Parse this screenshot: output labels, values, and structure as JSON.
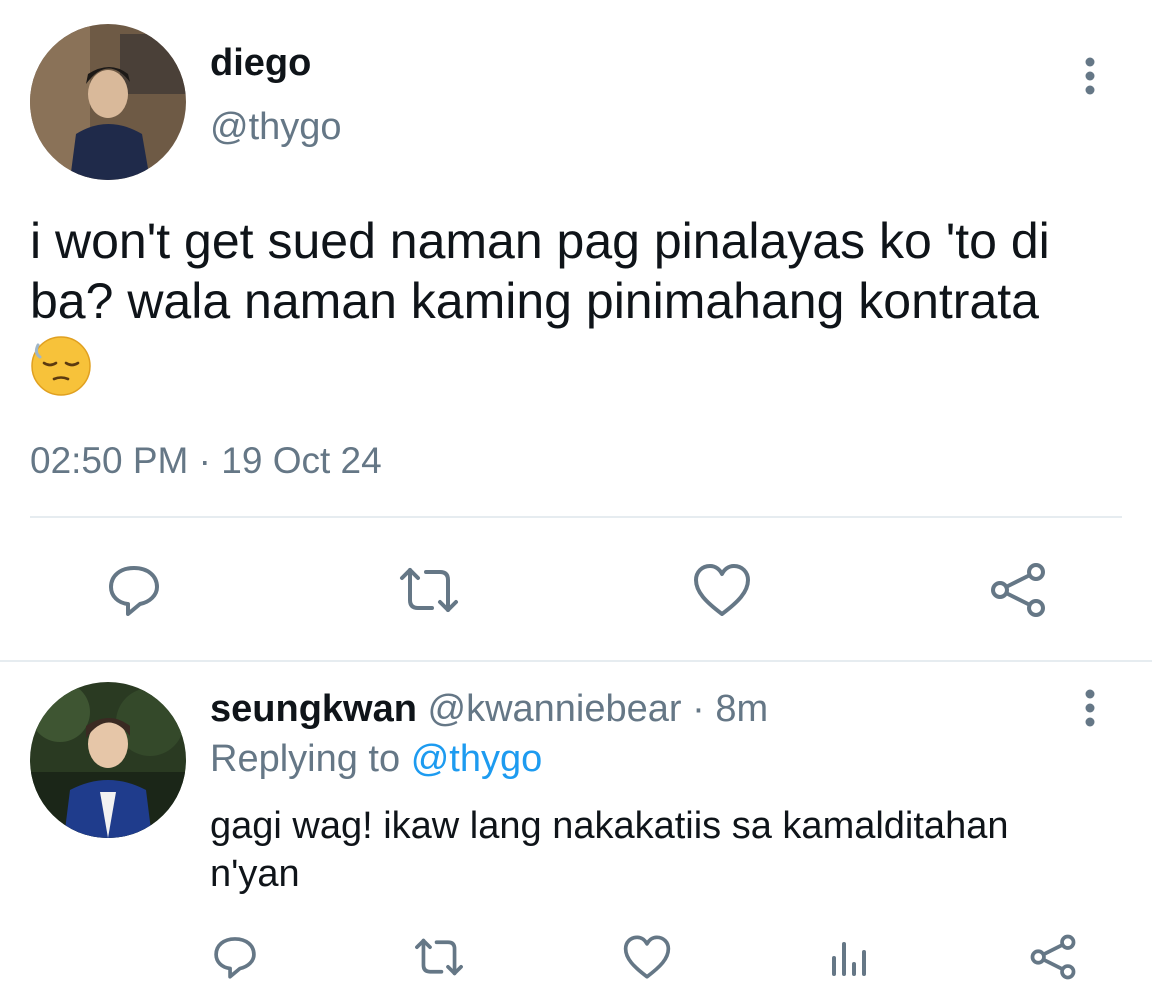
{
  "main_tweet": {
    "author": {
      "name": "diego",
      "handle": "@thygo"
    },
    "text_line1": "i won't get sued naman pag pinalayas ko 'to di",
    "text_line2": "ba? wala naman kaming pinimahang kontrata",
    "emoji_name": "sleepy-face-emoji",
    "time": "02:50 PM",
    "separator": "·",
    "date": "19 Oct 24",
    "actions": [
      "reply-icon",
      "retweet-icon",
      "like-icon",
      "share-icon"
    ]
  },
  "reply_tweet": {
    "author": {
      "name": "seungkwan",
      "handle": "@kwanniebear"
    },
    "separator": "·",
    "age": "8m",
    "replying_prefix": "Replying to",
    "replying_handle": "@thygo",
    "text_line1": "gagi wag! ikaw lang nakakatiis sa kamalditahan",
    "text_line2": "n'yan",
    "actions": [
      "reply-icon",
      "retweet-icon",
      "like-icon",
      "analytics-icon",
      "share-icon"
    ]
  },
  "colors": {
    "text": "#0f1419",
    "secondary": "#657786",
    "link": "#1d9bf0",
    "divider": "#e6ecf0"
  }
}
